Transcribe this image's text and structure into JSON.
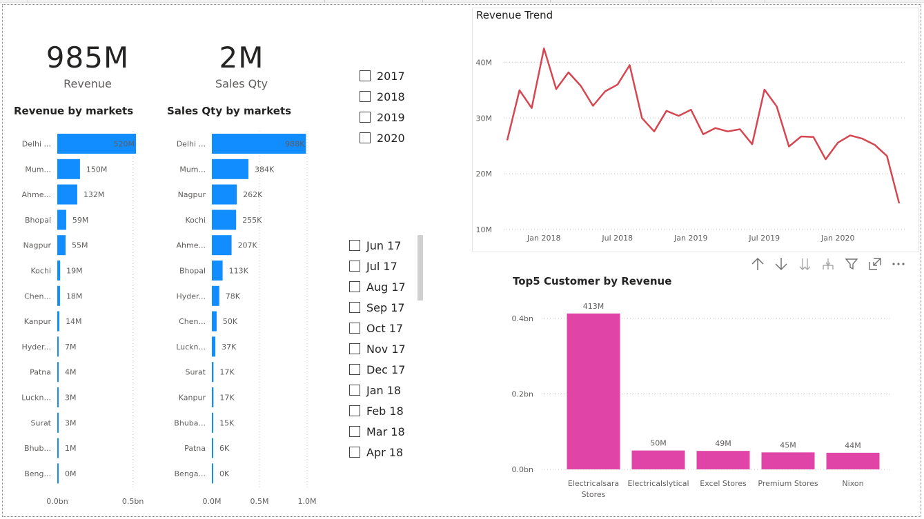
{
  "cards": {
    "revenue": {
      "value": "985M",
      "label": "Revenue"
    },
    "sales_qty": {
      "value": "2M",
      "label": "Sales Qty"
    }
  },
  "revenue_by_markets": {
    "title": "Revenue by markets"
  },
  "sales_qty_by_markets": {
    "title": "Sales Qty by markets"
  },
  "year_slicer": {
    "items": [
      "2017",
      "2018",
      "2019",
      "2020"
    ]
  },
  "month_slicer": {
    "items": [
      "Jun 17",
      "Jul 17",
      "Aug 17",
      "Sep 17",
      "Oct 17",
      "Nov 17",
      "Dec 17",
      "Jan 18",
      "Feb 18",
      "Mar 18",
      "Apr 18"
    ]
  },
  "revenue_trend": {
    "title": "Revenue Trend"
  },
  "top5": {
    "title": "Top5 Customer by Revenue"
  },
  "toolbar": {
    "icons": [
      "arrow-up-icon",
      "arrow-down-icon",
      "double-arrow-down-icon",
      "expand-hierarchy-icon",
      "filter-icon",
      "focus-mode-icon",
      "more-options-icon"
    ]
  },
  "colors": {
    "bar_blue": "#118dff",
    "line_red": "#d64550",
    "bar_pink": "#e044a7"
  },
  "chart_data": [
    {
      "id": "revenue_by_markets",
      "type": "bar",
      "orientation": "horizontal",
      "title": "Revenue by markets",
      "categories": [
        "Delhi ...",
        "Mum...",
        "Ahme...",
        "Bhopal",
        "Nagpur",
        "Kochi",
        "Chen...",
        "Kanpur",
        "Hyder...",
        "Patna",
        "Luckn...",
        "Surat",
        "Bhub...",
        "Beng..."
      ],
      "values": [
        520,
        150,
        132,
        59,
        55,
        19,
        18,
        14,
        7,
        4,
        3,
        3,
        1,
        0
      ],
      "unit": "M",
      "data_labels": [
        "520M",
        "150M",
        "132M",
        "59M",
        "55M",
        "19M",
        "18M",
        "14M",
        "7M",
        "4M",
        "3M",
        "3M",
        "1M",
        "0M"
      ],
      "xticks": [
        "0.0bn",
        "0.5bn"
      ],
      "xtick_values": [
        0,
        500
      ],
      "xlim": [
        0,
        520
      ]
    },
    {
      "id": "sales_qty_by_markets",
      "type": "bar",
      "orientation": "horizontal",
      "title": "Sales Qty by markets",
      "categories": [
        "Delhi ...",
        "Mum...",
        "Nagpur",
        "Kochi",
        "Ahme...",
        "Bhopal",
        "Hyder...",
        "Chen...",
        "Luckn...",
        "Surat",
        "Kanpur",
        "Bhuba...",
        "Patna",
        "Benga..."
      ],
      "values": [
        988,
        384,
        262,
        255,
        207,
        113,
        78,
        50,
        37,
        17,
        17,
        15,
        6,
        0
      ],
      "unit": "K",
      "data_labels": [
        "988K",
        "384K",
        "262K",
        "255K",
        "207K",
        "113K",
        "78K",
        "50K",
        "37K",
        "17K",
        "17K",
        "15K",
        "6K",
        "0K"
      ],
      "xticks": [
        "0.0M",
        "0.5M",
        "1.0M"
      ],
      "xtick_values": [
        0,
        500,
        1000
      ],
      "xlim": [
        0,
        1000
      ]
    },
    {
      "id": "revenue_trend",
      "type": "line",
      "title": "Revenue Trend",
      "x": [
        "Oct 2017",
        "Nov 2017",
        "Dec 2017",
        "Jan 2018",
        "Feb 2018",
        "Mar 2018",
        "Apr 2018",
        "May 2018",
        "Jun 2018",
        "Jul 2018",
        "Aug 2018",
        "Sep 2018",
        "Oct 2018",
        "Nov 2018",
        "Dec 2018",
        "Jan 2019",
        "Feb 2019",
        "Mar 2019",
        "Apr 2019",
        "May 2019",
        "Jun 2019",
        "Jul 2019",
        "Aug 2019",
        "Sep 2019",
        "Oct 2019",
        "Nov 2019",
        "Dec 2019",
        "Jan 2020",
        "Feb 2020",
        "Mar 2020",
        "Apr 2020",
        "May 2020",
        "Jun 2020"
      ],
      "values": [
        26,
        35,
        31.8,
        42.5,
        35.2,
        38.2,
        35.8,
        32.2,
        34.8,
        36,
        39.5,
        30,
        27.6,
        31.3,
        30.4,
        31.5,
        27.1,
        28.2,
        27.6,
        28,
        25.3,
        35.1,
        32.1,
        24.9,
        26.7,
        26.6,
        22.6,
        25.6,
        26.9,
        26.3,
        25.2,
        23.2,
        14.7
      ],
      "unit": "M",
      "yticks": [
        "10M",
        "20M",
        "30M",
        "40M"
      ],
      "ytick_values": [
        10,
        20,
        30,
        40
      ],
      "xticks": [
        "Jan 2018",
        "Jul 2018",
        "Jan 2019",
        "Jul 2019",
        "Jan 2020"
      ],
      "ylim": [
        10,
        45
      ]
    },
    {
      "id": "top5_customers",
      "type": "bar",
      "orientation": "vertical",
      "title": "Top5 Customer by Revenue",
      "categories": [
        "Electricalsara Stores",
        "Electricalslytical",
        "Excel Stores",
        "Premium Stores",
        "Nixon"
      ],
      "values": [
        413,
        50,
        49,
        45,
        44
      ],
      "unit": "M",
      "data_labels": [
        "413M",
        "50M",
        "49M",
        "45M",
        "44M"
      ],
      "yticks": [
        "0.0bn",
        "0.2bn",
        "0.4bn"
      ],
      "ytick_values": [
        0,
        200,
        400
      ],
      "ylim": [
        0,
        440
      ]
    }
  ]
}
